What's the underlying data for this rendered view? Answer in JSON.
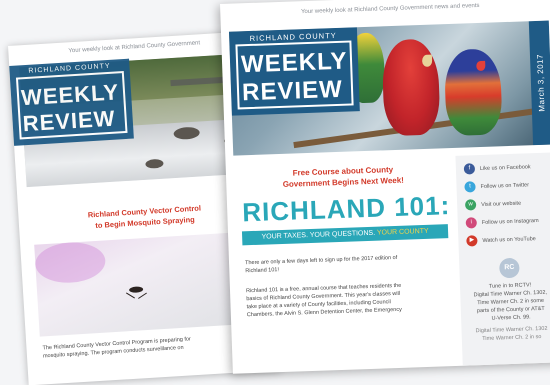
{
  "back": {
    "tagline": "Your weekly look at Richland County Government",
    "masthead": {
      "county": "RICHLAND COUNTY",
      "word1": "WEEKLY",
      "word2": "REVIEW"
    },
    "headline_line1": "Richland County Vector Control",
    "headline_line2": "to Begin Mosquito Spraying",
    "body_line1": "The Richland County Vector Control Program is preparing for",
    "body_line2": "mosquito spraying. The program conducts surveillance on"
  },
  "front": {
    "tagline": "Your weekly look at Richland County Government news and events",
    "masthead": {
      "county": "RICHLAND COUNTY",
      "word1": "WEEKLY",
      "word2": "REVIEW"
    },
    "date": "March 3, 2017",
    "course_line1": "Free Course about County",
    "course_line2": "Government Begins Next Week!",
    "big_title": "RICHLAND 101:",
    "band_main": "YOUR TAXES. YOUR QUESTIONS.",
    "band_accent": "YOUR COUNTY",
    "para1_line1": "There are only a few days left to sign up for the 2017 edition of",
    "para1_line2": "Richland 101!",
    "para2_line1": "Richland 101 is a free, annual course that teaches residents the",
    "para2_line2": "basics of Richland County Government. This year's classes will",
    "para2_line3": "take place at a variety of County facilities, including Council",
    "para2_line4": "Chambers, the Alvin S. Glenn Detention Center, the Emergency",
    "sidebar": {
      "social": [
        {
          "label": "Like us on Facebook",
          "icon": "f",
          "color": "#3b5b9a"
        },
        {
          "label": "Follow us on Twitter",
          "icon": "t",
          "color": "#39a6dc"
        },
        {
          "label": "Visit our website",
          "icon": "w",
          "color": "#3aa363"
        },
        {
          "label": "Follow us on Instagram",
          "icon": "i",
          "color": "#d14a7a"
        },
        {
          "label": "Watch us on YouTube",
          "icon": "▶",
          "color": "#d23a2a"
        }
      ],
      "rctv_badge": "RC",
      "tv_line1": "Tune in to RCTV!",
      "tv_line2": "Digital Time Warner Ch. 1302,",
      "tv_line3": "Time Warner Ch. 2 in some",
      "tv_line4": "parts of the County or AT&T",
      "tv_line5": "U-Verse Ch. 99.",
      "tv_dup1": "Digital Time Warner Ch. 1302",
      "tv_dup2": "Time Warner Ch. 2 in so"
    }
  }
}
